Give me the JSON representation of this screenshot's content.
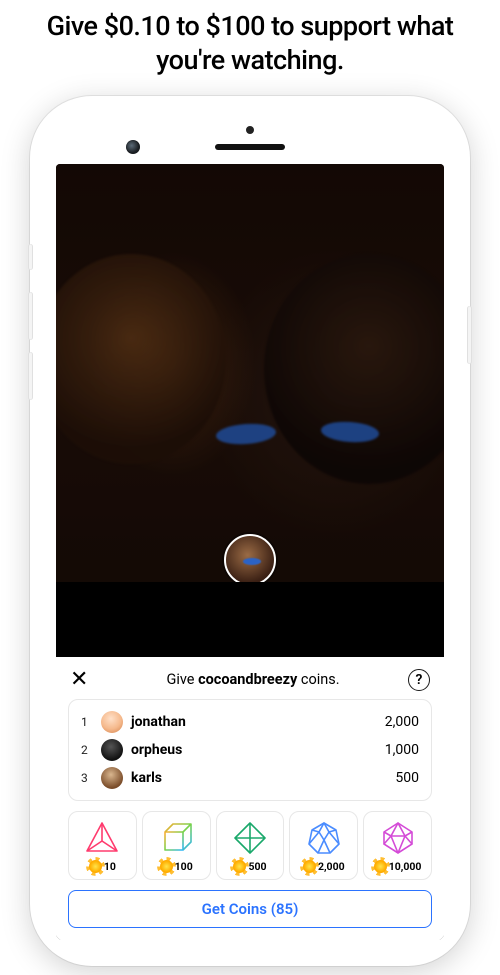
{
  "headline": "Give $0.10 to $100 to support what you're watching.",
  "panel": {
    "title_prefix": "Give ",
    "title_user": "cocoandbreezy",
    "title_suffix": " coins.",
    "help_symbol": "?",
    "close_symbol": "✕"
  },
  "leaderboard": [
    {
      "rank": "1",
      "name": "jonathan",
      "coins": "2,000"
    },
    {
      "rank": "2",
      "name": "orpheus",
      "coins": "1,000"
    },
    {
      "rank": "3",
      "name": "karls",
      "coins": "500"
    }
  ],
  "coin_options": [
    {
      "amount": "10"
    },
    {
      "amount": "100"
    },
    {
      "amount": "500"
    },
    {
      "amount": "2,000"
    },
    {
      "amount": "10,000"
    }
  ],
  "cta": {
    "label": "Get Coins (85)"
  }
}
